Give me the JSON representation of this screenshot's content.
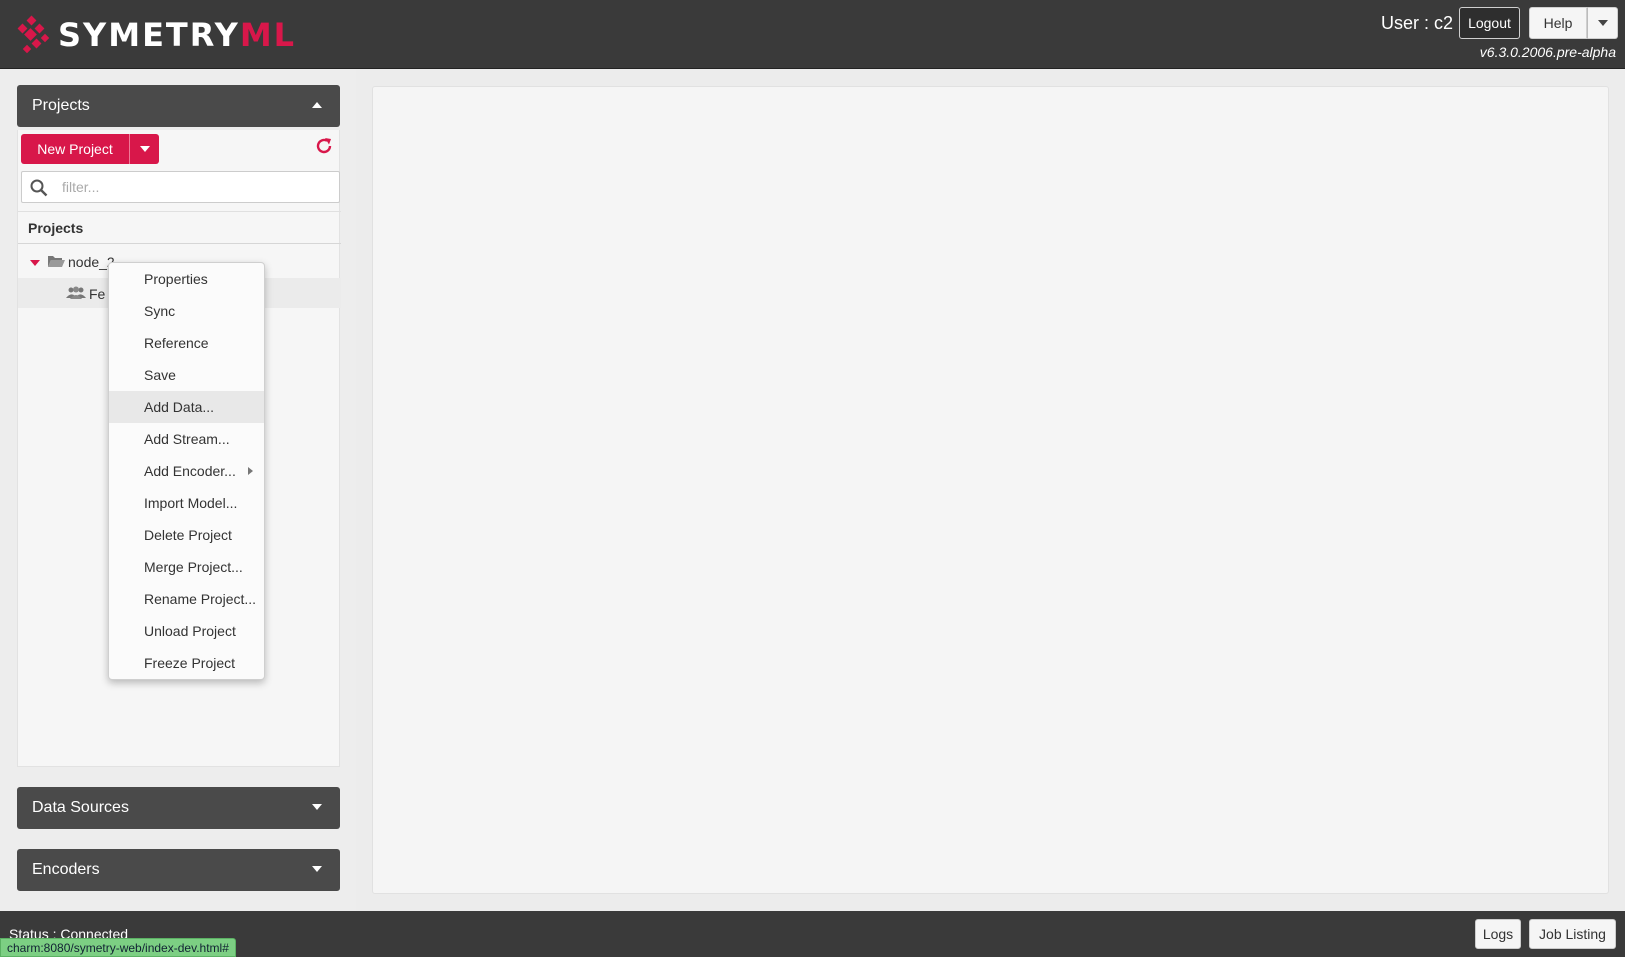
{
  "header": {
    "logo_text_main": "SYMETRY",
    "logo_text_accent": "ML",
    "user_label": "User : c2",
    "logout_label": "Logout",
    "help_label": "Help",
    "version": "v6.3.0.2006.pre-alpha"
  },
  "sidebar": {
    "projects_panel": {
      "title": "Projects",
      "new_project_label": "New Project",
      "filter_placeholder": "filter...",
      "tree_header": "Projects",
      "tree": {
        "node_label": "node_2",
        "child_label": "Fe"
      }
    },
    "data_sources_panel": {
      "title": "Data Sources"
    },
    "encoders_panel": {
      "title": "Encoders"
    }
  },
  "context_menu": {
    "items": [
      {
        "label": "Properties"
      },
      {
        "label": "Sync"
      },
      {
        "label": "Reference"
      },
      {
        "label": "Save"
      },
      {
        "label": "Add Data...",
        "highlighted": true
      },
      {
        "label": "Add Stream..."
      },
      {
        "label": "Add Encoder...",
        "has_submenu": true
      },
      {
        "label": "Import Model..."
      },
      {
        "label": "Delete Project"
      },
      {
        "label": "Merge Project..."
      },
      {
        "label": "Rename Project..."
      },
      {
        "label": "Unload Project"
      },
      {
        "label": "Freeze Project"
      }
    ]
  },
  "footer": {
    "status": "Status : Connected",
    "logs_label": "Logs",
    "job_listing_label": "Job Listing",
    "url_tooltip": "charm:8080/symetry-web/index-dev.html#"
  },
  "colors": {
    "accent": "#d8174a",
    "header_bg": "#3a3a3a",
    "panel_head_bg": "#4a4a4a",
    "status_green": "#7ccf83"
  }
}
